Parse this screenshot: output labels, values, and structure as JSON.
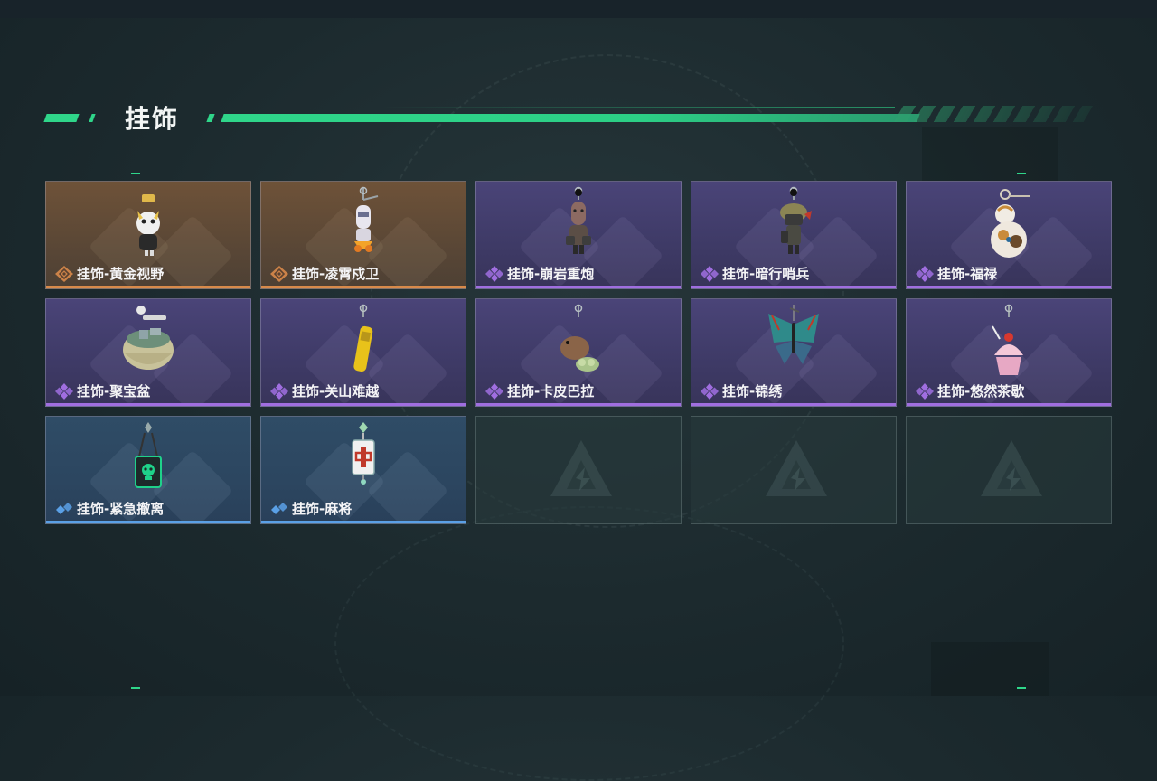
{
  "section": {
    "title": "挂饰"
  },
  "items": [
    {
      "label": "挂饰-黄金视野",
      "rarity": "orange",
      "icon": "pendant-golden-vision-icon"
    },
    {
      "label": "挂饰-凌霄戍卫",
      "rarity": "orange",
      "icon": "pendant-lingxiao-guard-icon"
    },
    {
      "label": "挂饰-崩岩重炮",
      "rarity": "purple",
      "icon": "pendant-rock-cannon-icon"
    },
    {
      "label": "挂饰-暗行哨兵",
      "rarity": "purple",
      "icon": "pendant-shadow-sentry-icon"
    },
    {
      "label": "挂饰-福禄",
      "rarity": "purple",
      "icon": "pendant-gourd-icon"
    },
    {
      "label": "挂饰-聚宝盆",
      "rarity": "purple",
      "icon": "pendant-treasure-bowl-icon"
    },
    {
      "label": "挂饰-关山难越",
      "rarity": "purple",
      "icon": "pendant-yellow-tube-icon"
    },
    {
      "label": "挂饰-卡皮巴拉",
      "rarity": "purple",
      "icon": "pendant-capybara-icon"
    },
    {
      "label": "挂饰-锦绣",
      "rarity": "purple",
      "icon": "pendant-butterfly-icon"
    },
    {
      "label": "挂饰-悠然茶歇",
      "rarity": "purple",
      "icon": "pendant-cupcake-icon"
    },
    {
      "label": "挂饰-紧急撤离",
      "rarity": "blue",
      "icon": "pendant-skull-box-icon"
    },
    {
      "label": "挂饰-麻将",
      "rarity": "blue",
      "icon": "pendant-mahjong-icon"
    },
    {
      "label": "",
      "rarity": "empty",
      "icon": "empty-slot-logo-icon"
    },
    {
      "label": "",
      "rarity": "empty",
      "icon": "empty-slot-logo-icon"
    },
    {
      "label": "",
      "rarity": "empty",
      "icon": "empty-slot-logo-icon"
    }
  ],
  "colors": {
    "accent": "#2fd68a",
    "orange": "#d88a4a",
    "purple": "#a06ee0",
    "blue": "#5aa0e6"
  }
}
